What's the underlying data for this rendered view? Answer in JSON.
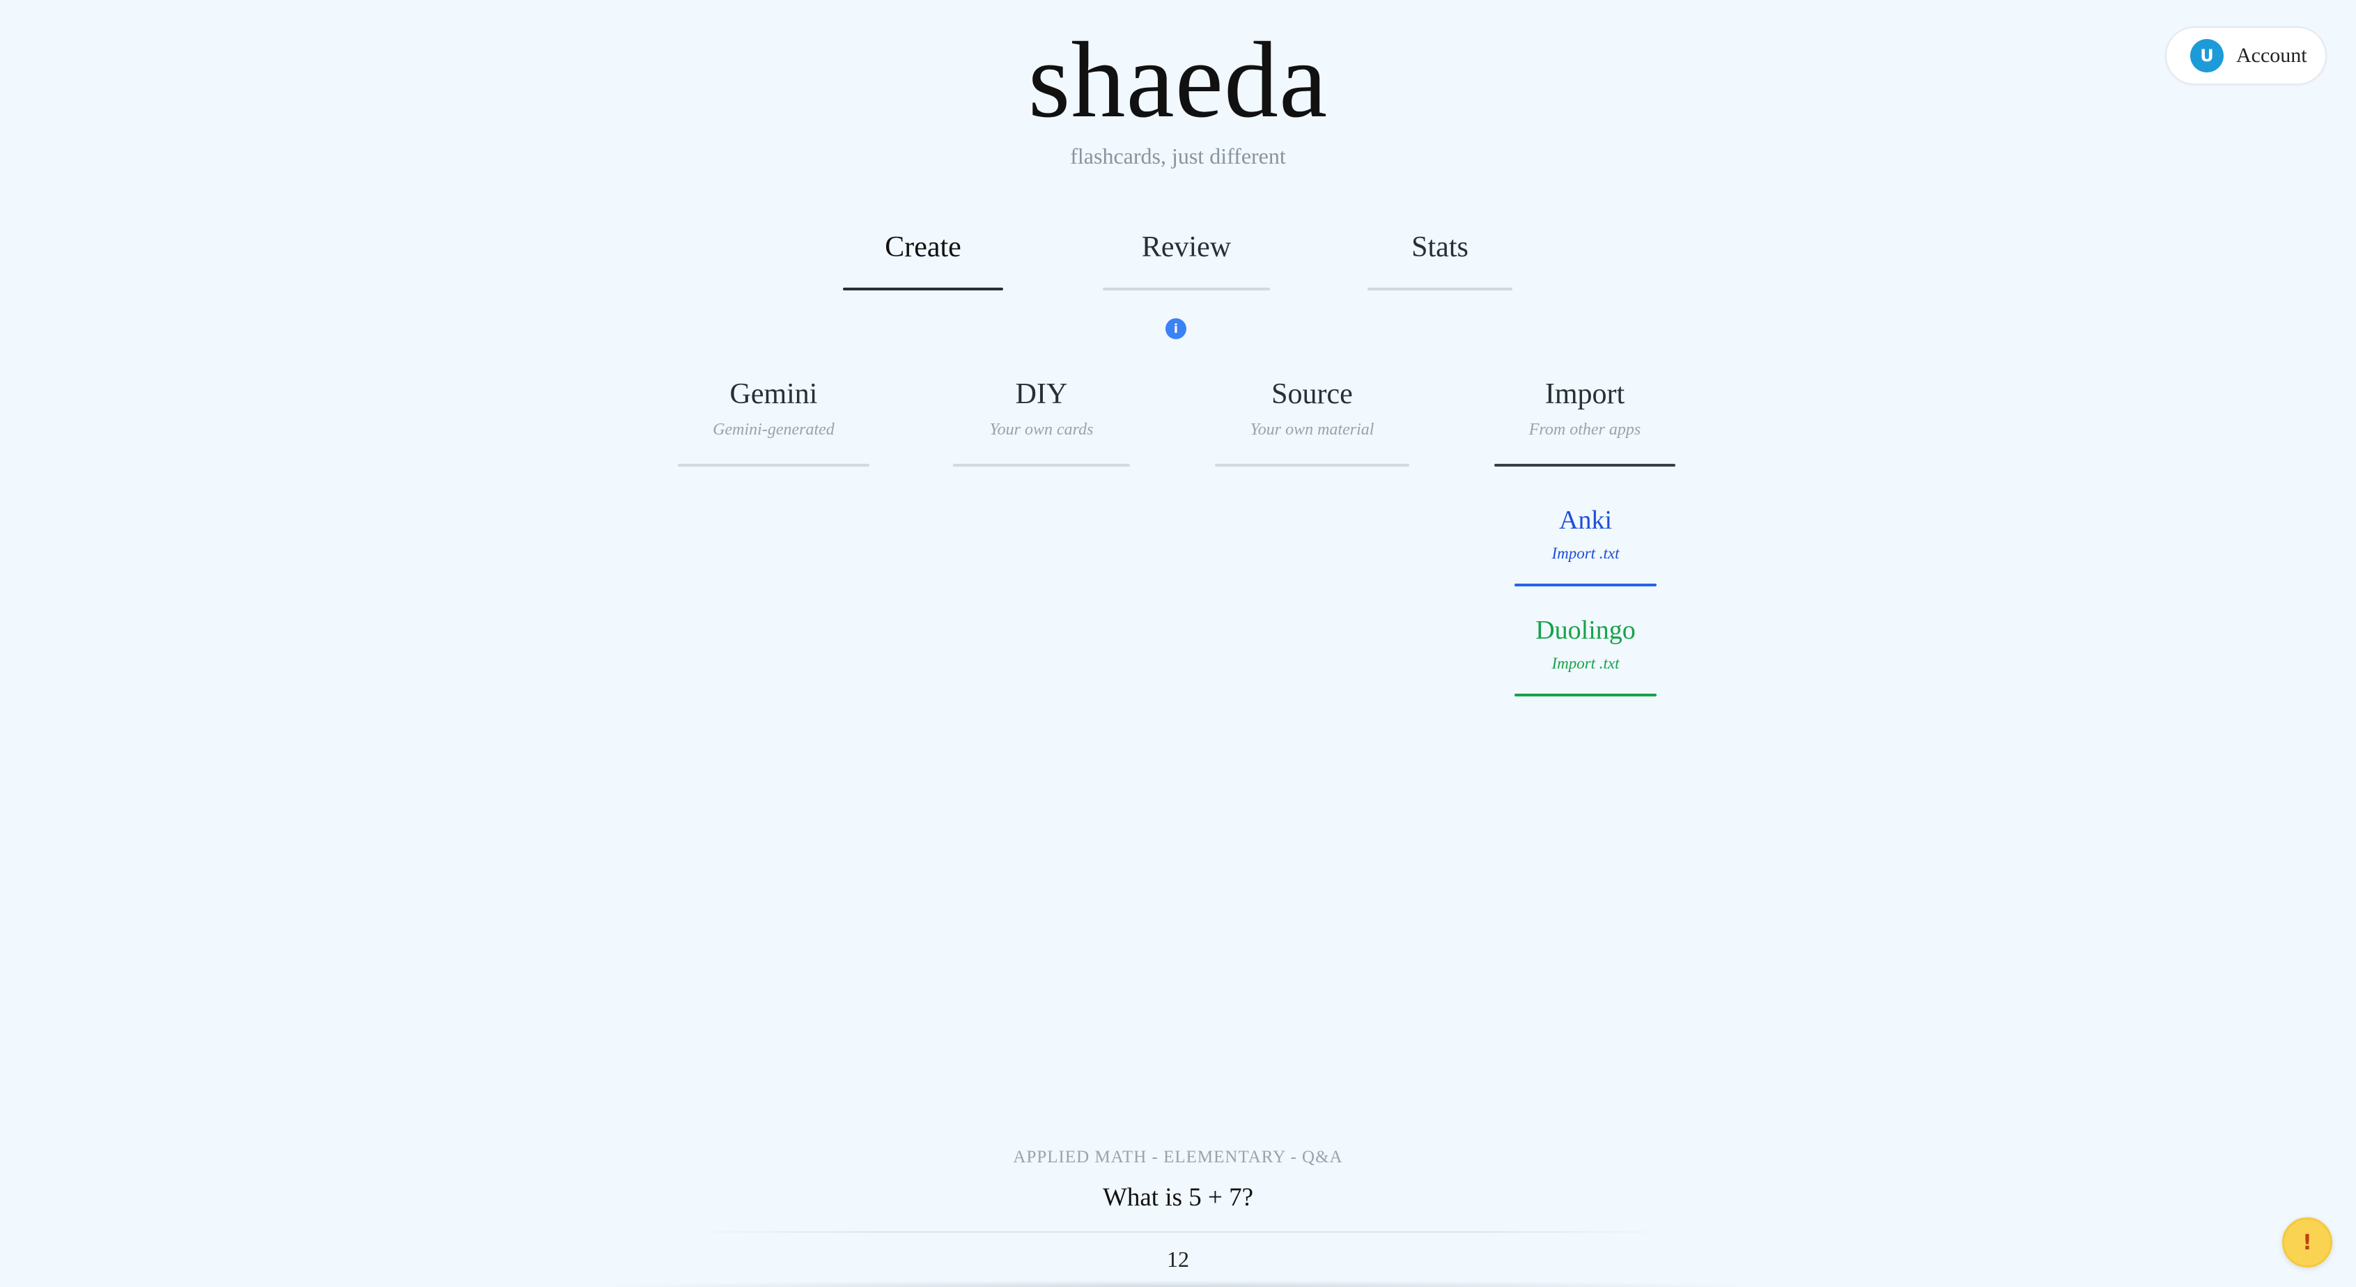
{
  "app": {
    "title": "shaeda",
    "tagline": "flashcards, just different"
  },
  "account": {
    "avatar_initial": "U",
    "label": "Account"
  },
  "main_tabs": [
    {
      "label": "Create",
      "active": true
    },
    {
      "label": "Review",
      "active": false
    },
    {
      "label": "Stats",
      "active": false
    }
  ],
  "info_icon": {
    "glyph": "i",
    "icon": "info-icon",
    "color": "#3b82f6"
  },
  "sub_tabs": [
    {
      "label": "Gemini",
      "description": "Gemini-generated",
      "active": false
    },
    {
      "label": "DIY",
      "description": "Your own cards",
      "active": false
    },
    {
      "label": "Source",
      "description": "Your own material",
      "active": false
    },
    {
      "label": "Import",
      "description": "From other apps",
      "active": true
    }
  ],
  "import_options": [
    {
      "label": "Anki",
      "description": "Import .txt",
      "color": "#1d4ed8"
    },
    {
      "label": "Duolingo",
      "description": "Import .txt",
      "color": "#16a34a"
    }
  ],
  "card": {
    "category": "APPLIED MATH - ELEMENTARY - Q&A",
    "question": "What is 5 + 7?",
    "answer": "12"
  },
  "feedback_button": {
    "glyph": "!",
    "icon": "alert-icon",
    "color": "#fbd352"
  }
}
